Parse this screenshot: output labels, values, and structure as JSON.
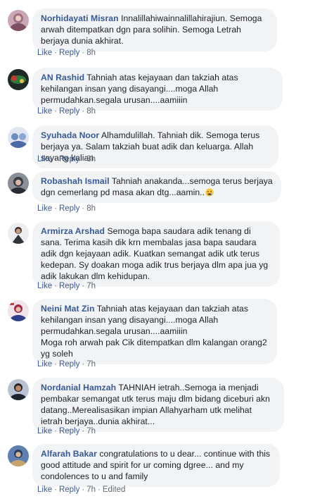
{
  "actions": {
    "like_label": "Like",
    "reply_label": "Reply",
    "separator": "·"
  },
  "comments": [
    {
      "author": "Norhidayati Misran",
      "text": "Innalillahiwainnalillahirajiun. Semoga arwah ditempatkan dgn para solihin. Semoga Letrah berjaya dunia akhirat.",
      "time": "8h",
      "edited": ""
    },
    {
      "author": "AN Rashid",
      "text": "Tahniah atas kejayaan dan takziah atas kehilangan insan yang disayangi....moga Allah permudahkan.segala urusan....aamiiin",
      "time": "8h",
      "edited": ""
    },
    {
      "author": "Syuhada Noor",
      "text": "Alhamdulillah. Tahniah dik. Semoga terus berjaya ya. Salam takziah buat adik dan keluarga. Allah sayang kalian.",
      "time": "8h",
      "edited": ""
    },
    {
      "author": "Robashah Ismail",
      "text": "Tahniah anakanda...semoga terus berjaya dgn cemerlang pd masa akan dtg...aamin..",
      "emoji": "crying-face",
      "time": "8h",
      "edited": ""
    },
    {
      "author": "Armirza Arshad",
      "text": "Semoga bapa saudara adik tenang di sana. Terima kasih dik krn membalas jasa bapa saudara adik dgn kejayaan adik. Kuatkan semangat adik utk terus kedepan. Sy doakan moga adik trus berjaya dlm apa jua yg adik lakukan dlm kehidupan.",
      "time": "7h",
      "edited": ""
    },
    {
      "author": "Neini Mat Zin",
      "text": "Tahniah atas kejayaan dan takziah atas kehilangan insan yang disayangi....moga Allah permudahkan.segala urusan....aamiiin",
      "text2": "Moga roh arwah pak Cik ditempatkan dlm kalangan orang2 yg soleh",
      "time": "7h",
      "edited": ""
    },
    {
      "author": "Nordanial Hamzah",
      "text": "TAHNIAH ietrah..Semoga ia menjadi pembakar semangat utk terus maju dlm bidang diceburi akn datang..Merealisasikan impian Allahyarham utk melihat ietrah berjaya..dunia akhirat...",
      "time": "7h",
      "edited": ""
    },
    {
      "author": "Alfarah Bakar",
      "text": "congratulations to u dear... continue with this good attitude and spirit for ur coming dgree... and my condolences to u and family",
      "time": "7h",
      "edited": "Edited"
    }
  ]
}
